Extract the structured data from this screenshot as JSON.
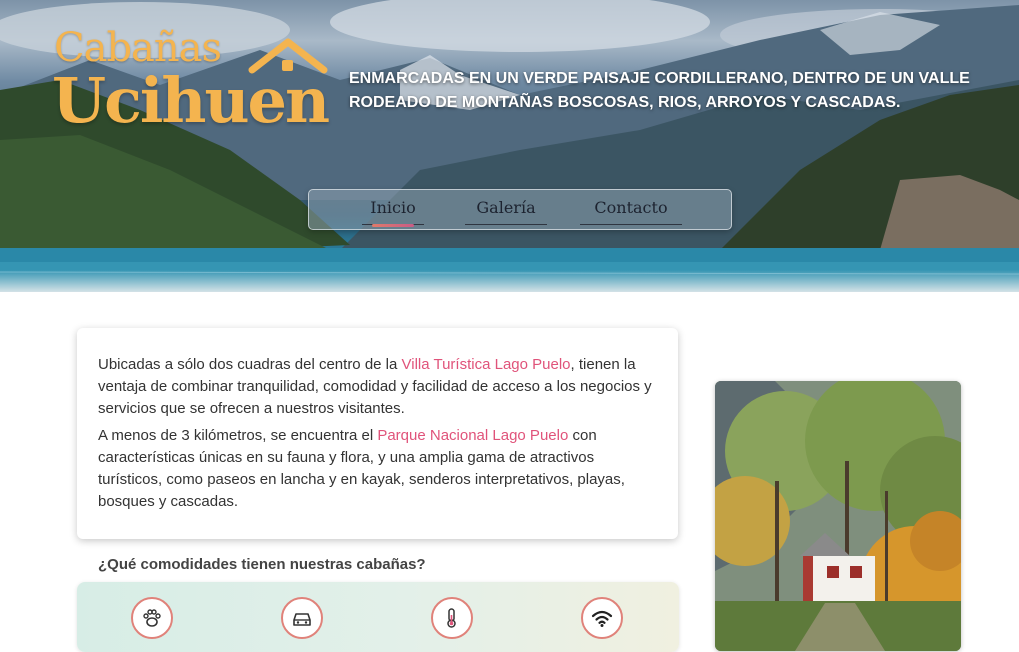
{
  "header": {
    "logo_line1": "Cabañas",
    "logo_line2": "Ucihuen",
    "tagline": "ENMARCADAS EN UN VERDE PAISAJE CORDILLERANO, DENTRO DE UN VALLE RODEADO DE MONTAÑAS BOSCOSAS, RIOS, ARROYOS Y CASCADAS."
  },
  "nav": {
    "items": [
      {
        "label": "Inicio",
        "active": true
      },
      {
        "label": "Galería",
        "active": false
      },
      {
        "label": "Contacto",
        "active": false
      }
    ]
  },
  "intro": {
    "p1_before": "Ubicadas a sólo dos cuadras del centro de la ",
    "p1_link": "Villa Turística Lago Puelo",
    "p1_after": ", tienen la ventaja de combinar tranquilidad, comodidad y facilidad de acceso a los negocios y servicios que se ofrecen a nuestros visitantes.",
    "p2_before": "A menos de 3 kilómetros, se encuentra el ",
    "p2_link": "Parque Nacional Lago Puelo",
    "p2_after": " con características únicas en su fauna y flora, y una amplia gama de atractivos turísticos, como paseos en lancha y en kayak, senderos interpretativos, playas, bosques y cascadas."
  },
  "amenities": {
    "title": "¿Qué comodidades tienen nuestras cabañas?",
    "icons": [
      "paw-icon",
      "car-icon",
      "thermometer-icon",
      "wifi-icon"
    ]
  },
  "colors": {
    "logo": "#f4b44f",
    "link": "#e0537a",
    "icon_ring": "#e0827a"
  }
}
